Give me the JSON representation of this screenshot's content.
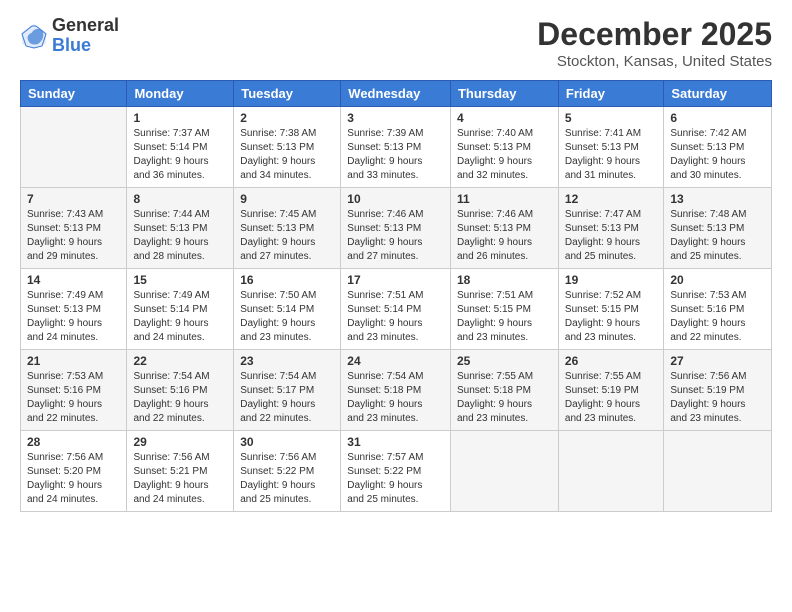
{
  "logo": {
    "general": "General",
    "blue": "Blue"
  },
  "header": {
    "title": "December 2025",
    "subtitle": "Stockton, Kansas, United States"
  },
  "weekdays": [
    "Sunday",
    "Monday",
    "Tuesday",
    "Wednesday",
    "Thursday",
    "Friday",
    "Saturday"
  ],
  "weeks": [
    [
      {
        "num": "",
        "info": ""
      },
      {
        "num": "1",
        "info": "Sunrise: 7:37 AM\nSunset: 5:14 PM\nDaylight: 9 hours\nand 36 minutes."
      },
      {
        "num": "2",
        "info": "Sunrise: 7:38 AM\nSunset: 5:13 PM\nDaylight: 9 hours\nand 34 minutes."
      },
      {
        "num": "3",
        "info": "Sunrise: 7:39 AM\nSunset: 5:13 PM\nDaylight: 9 hours\nand 33 minutes."
      },
      {
        "num": "4",
        "info": "Sunrise: 7:40 AM\nSunset: 5:13 PM\nDaylight: 9 hours\nand 32 minutes."
      },
      {
        "num": "5",
        "info": "Sunrise: 7:41 AM\nSunset: 5:13 PM\nDaylight: 9 hours\nand 31 minutes."
      },
      {
        "num": "6",
        "info": "Sunrise: 7:42 AM\nSunset: 5:13 PM\nDaylight: 9 hours\nand 30 minutes."
      }
    ],
    [
      {
        "num": "7",
        "info": "Sunrise: 7:43 AM\nSunset: 5:13 PM\nDaylight: 9 hours\nand 29 minutes."
      },
      {
        "num": "8",
        "info": "Sunrise: 7:44 AM\nSunset: 5:13 PM\nDaylight: 9 hours\nand 28 minutes."
      },
      {
        "num": "9",
        "info": "Sunrise: 7:45 AM\nSunset: 5:13 PM\nDaylight: 9 hours\nand 27 minutes."
      },
      {
        "num": "10",
        "info": "Sunrise: 7:46 AM\nSunset: 5:13 PM\nDaylight: 9 hours\nand 27 minutes."
      },
      {
        "num": "11",
        "info": "Sunrise: 7:46 AM\nSunset: 5:13 PM\nDaylight: 9 hours\nand 26 minutes."
      },
      {
        "num": "12",
        "info": "Sunrise: 7:47 AM\nSunset: 5:13 PM\nDaylight: 9 hours\nand 25 minutes."
      },
      {
        "num": "13",
        "info": "Sunrise: 7:48 AM\nSunset: 5:13 PM\nDaylight: 9 hours\nand 25 minutes."
      }
    ],
    [
      {
        "num": "14",
        "info": "Sunrise: 7:49 AM\nSunset: 5:13 PM\nDaylight: 9 hours\nand 24 minutes."
      },
      {
        "num": "15",
        "info": "Sunrise: 7:49 AM\nSunset: 5:14 PM\nDaylight: 9 hours\nand 24 minutes."
      },
      {
        "num": "16",
        "info": "Sunrise: 7:50 AM\nSunset: 5:14 PM\nDaylight: 9 hours\nand 23 minutes."
      },
      {
        "num": "17",
        "info": "Sunrise: 7:51 AM\nSunset: 5:14 PM\nDaylight: 9 hours\nand 23 minutes."
      },
      {
        "num": "18",
        "info": "Sunrise: 7:51 AM\nSunset: 5:15 PM\nDaylight: 9 hours\nand 23 minutes."
      },
      {
        "num": "19",
        "info": "Sunrise: 7:52 AM\nSunset: 5:15 PM\nDaylight: 9 hours\nand 23 minutes."
      },
      {
        "num": "20",
        "info": "Sunrise: 7:53 AM\nSunset: 5:16 PM\nDaylight: 9 hours\nand 22 minutes."
      }
    ],
    [
      {
        "num": "21",
        "info": "Sunrise: 7:53 AM\nSunset: 5:16 PM\nDaylight: 9 hours\nand 22 minutes."
      },
      {
        "num": "22",
        "info": "Sunrise: 7:54 AM\nSunset: 5:16 PM\nDaylight: 9 hours\nand 22 minutes."
      },
      {
        "num": "23",
        "info": "Sunrise: 7:54 AM\nSunset: 5:17 PM\nDaylight: 9 hours\nand 22 minutes."
      },
      {
        "num": "24",
        "info": "Sunrise: 7:54 AM\nSunset: 5:18 PM\nDaylight: 9 hours\nand 23 minutes."
      },
      {
        "num": "25",
        "info": "Sunrise: 7:55 AM\nSunset: 5:18 PM\nDaylight: 9 hours\nand 23 minutes."
      },
      {
        "num": "26",
        "info": "Sunrise: 7:55 AM\nSunset: 5:19 PM\nDaylight: 9 hours\nand 23 minutes."
      },
      {
        "num": "27",
        "info": "Sunrise: 7:56 AM\nSunset: 5:19 PM\nDaylight: 9 hours\nand 23 minutes."
      }
    ],
    [
      {
        "num": "28",
        "info": "Sunrise: 7:56 AM\nSunset: 5:20 PM\nDaylight: 9 hours\nand 24 minutes."
      },
      {
        "num": "29",
        "info": "Sunrise: 7:56 AM\nSunset: 5:21 PM\nDaylight: 9 hours\nand 24 minutes."
      },
      {
        "num": "30",
        "info": "Sunrise: 7:56 AM\nSunset: 5:22 PM\nDaylight: 9 hours\nand 25 minutes."
      },
      {
        "num": "31",
        "info": "Sunrise: 7:57 AM\nSunset: 5:22 PM\nDaylight: 9 hours\nand 25 minutes."
      },
      {
        "num": "",
        "info": ""
      },
      {
        "num": "",
        "info": ""
      },
      {
        "num": "",
        "info": ""
      }
    ]
  ]
}
